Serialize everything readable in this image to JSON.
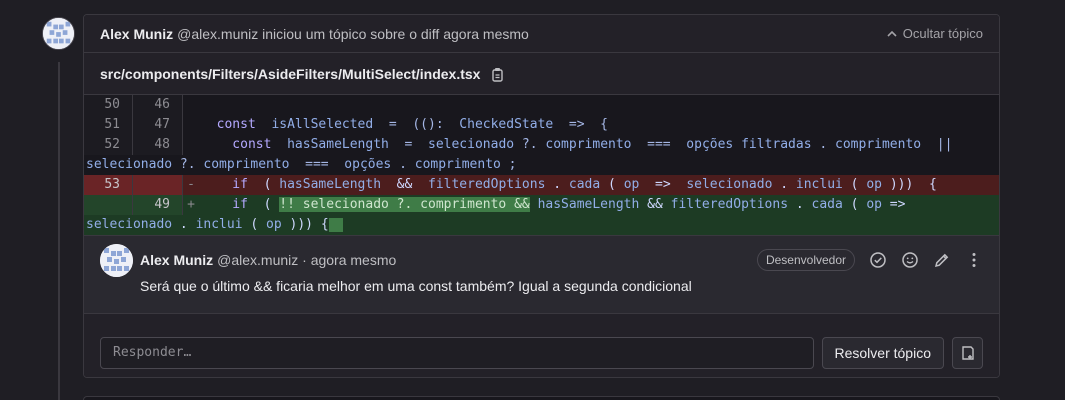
{
  "thread": {
    "author": "Alex Muniz",
    "meta": "@alex.muniz iniciou um tópico sobre o diff agora mesmo",
    "toggle_label": "Ocultar tópico"
  },
  "file": {
    "path": "src/components/Filters/AsideFilters/MultiSelect/index.tsx"
  },
  "diff": {
    "rows": [
      {
        "old": "50",
        "new": "46"
      },
      {
        "old": "51",
        "new": "47"
      },
      {
        "old": "52",
        "new": "48"
      },
      {
        "old": "53",
        "new": "",
        "sign": "-"
      },
      {
        "old": "",
        "new": "49",
        "sign": "+"
      }
    ]
  },
  "comment": {
    "author": "Alex Muniz",
    "meta": "@alex.muniz · agora mesmo",
    "badge": "Desenvolvedor",
    "body": "Será que o último && ficaria melhor em uma const também? Igual a segunda condicional"
  },
  "reply": {
    "placeholder": "Responder…",
    "resolve_label": "Resolver tópico"
  },
  "icons": {
    "toggle": "chevron-up-icon",
    "copy": "copy-icon",
    "resolve": "check-circle-icon",
    "emoji": "smiley-icon",
    "edit": "pencil-icon",
    "more": "kebab-icon",
    "issue": "issue-icon"
  }
}
